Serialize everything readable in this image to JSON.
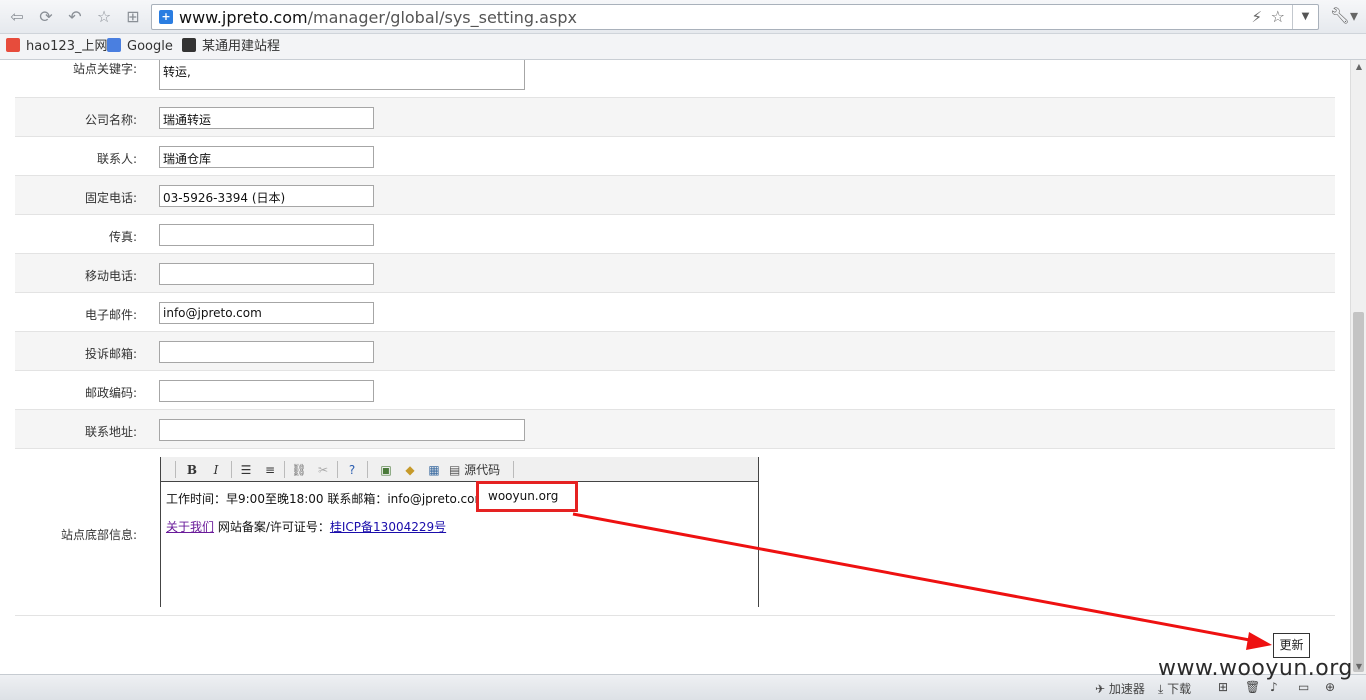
{
  "browser": {
    "url_host": "www.jpreto.com",
    "url_path": "/manager/global/sys_setting.aspx",
    "bookmarks": [
      "hao123_上网",
      "Google",
      "某通用建站程"
    ]
  },
  "form": {
    "keywords_label": "站点关键字:",
    "keywords_value": "转运,",
    "company_label": "公司名称:",
    "company_value": "瑞通转运",
    "contact_label": "联系人:",
    "contact_value": "瑞通仓库",
    "phone_label": "固定电话:",
    "phone_value": "03-5926-3394 (日本)",
    "fax_label": "传真:",
    "fax_value": "",
    "mobile_label": "移动电话:",
    "mobile_value": "",
    "email_label": "电子邮件:",
    "email_value": "info@jpreto.com",
    "complaint_label": "投诉邮箱:",
    "complaint_value": "",
    "zip_label": "邮政编码:",
    "zip_value": "",
    "address_label": "联系地址:",
    "address_value": "",
    "footer_label": "站点底部信息:"
  },
  "editor": {
    "toolbar": {
      "bold": "B",
      "italic": "I",
      "source_label": "源代码"
    },
    "line1": "工作时间：早9:00至晚18:00  联系邮箱：info@jpreto.com",
    "injected": "wooyun.org",
    "about_link": "关于我们",
    "icp_text": "网站备案/许可证号：",
    "icp_link": "桂ICP备13004229号"
  },
  "update_label": "更新",
  "statusbar": {
    "accelerator": "加速器",
    "download": "下载"
  },
  "watermark": "www.wooyun.org"
}
